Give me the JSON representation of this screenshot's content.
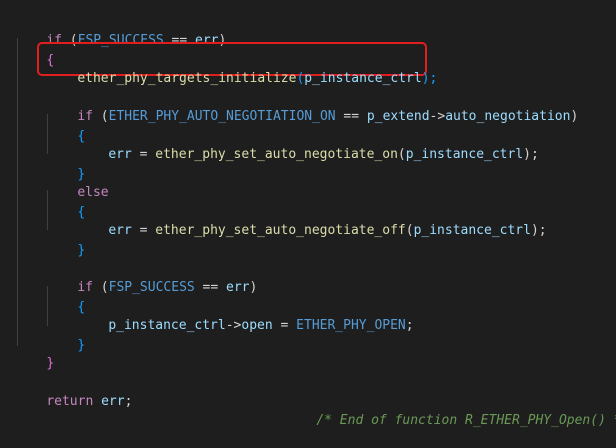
{
  "code": {
    "l1": {
      "kw": "if",
      "lp": " (",
      "macro": "FSP_SUCCESS",
      "op": " == ",
      "var": "err",
      "rp": ")"
    },
    "l2": {
      "brace": "{"
    },
    "l3": {
      "fn": "ether_phy_targets_initialize",
      "lp": "(",
      "var": "p_instance_ctrl",
      "rp": ");"
    },
    "l4": {
      "kw": "if",
      "lp": " (",
      "macro": "ETHER_PHY_AUTO_NEGOTIATION_ON",
      "op": " == ",
      "var": "p_extend",
      "arrow": "->",
      "member": "auto_negotiation",
      "rp": ")"
    },
    "l5": {
      "brace": "{"
    },
    "l6": {
      "var": "err",
      "op": " = ",
      "fn": "ether_phy_set_auto_negotiate_on",
      "lp": "(",
      "arg": "p_instance_ctrl",
      "rp": ");"
    },
    "l7": {
      "brace": "}"
    },
    "l8": {
      "kw": "else"
    },
    "l9": {
      "brace": "{"
    },
    "l10": {
      "var": "err",
      "op": " = ",
      "fn": "ether_phy_set_auto_negotiate_off",
      "lp": "(",
      "arg": "p_instance_ctrl",
      "rp": ");"
    },
    "l11": {
      "brace": "}"
    },
    "l12": {
      "kw": "if",
      "lp": " (",
      "macro": "FSP_SUCCESS",
      "op": " == ",
      "var": "err",
      "rp": ")"
    },
    "l13": {
      "brace": "{"
    },
    "l14": {
      "var": "p_instance_ctrl",
      "arrow": "->",
      "member": "open",
      "op": " = ",
      "macro": "ETHER_PHY_OPEN",
      "semi": ";"
    },
    "l15": {
      "brace": "}"
    },
    "l16": {
      "brace": "}"
    },
    "l17": {
      "kw": "return",
      "var": " err",
      "semi": ";"
    },
    "l18": {
      "comment": "/* End of function R_ETHER_PHY_Open() */"
    }
  },
  "colors": {
    "background": "#1e1e1e",
    "keyword_control": "#c586c0",
    "macro": "#569cd6",
    "variable": "#9cdcfe",
    "function": "#dcdcaa",
    "comment": "#6a9955",
    "highlight_border": "#e01e1e"
  }
}
